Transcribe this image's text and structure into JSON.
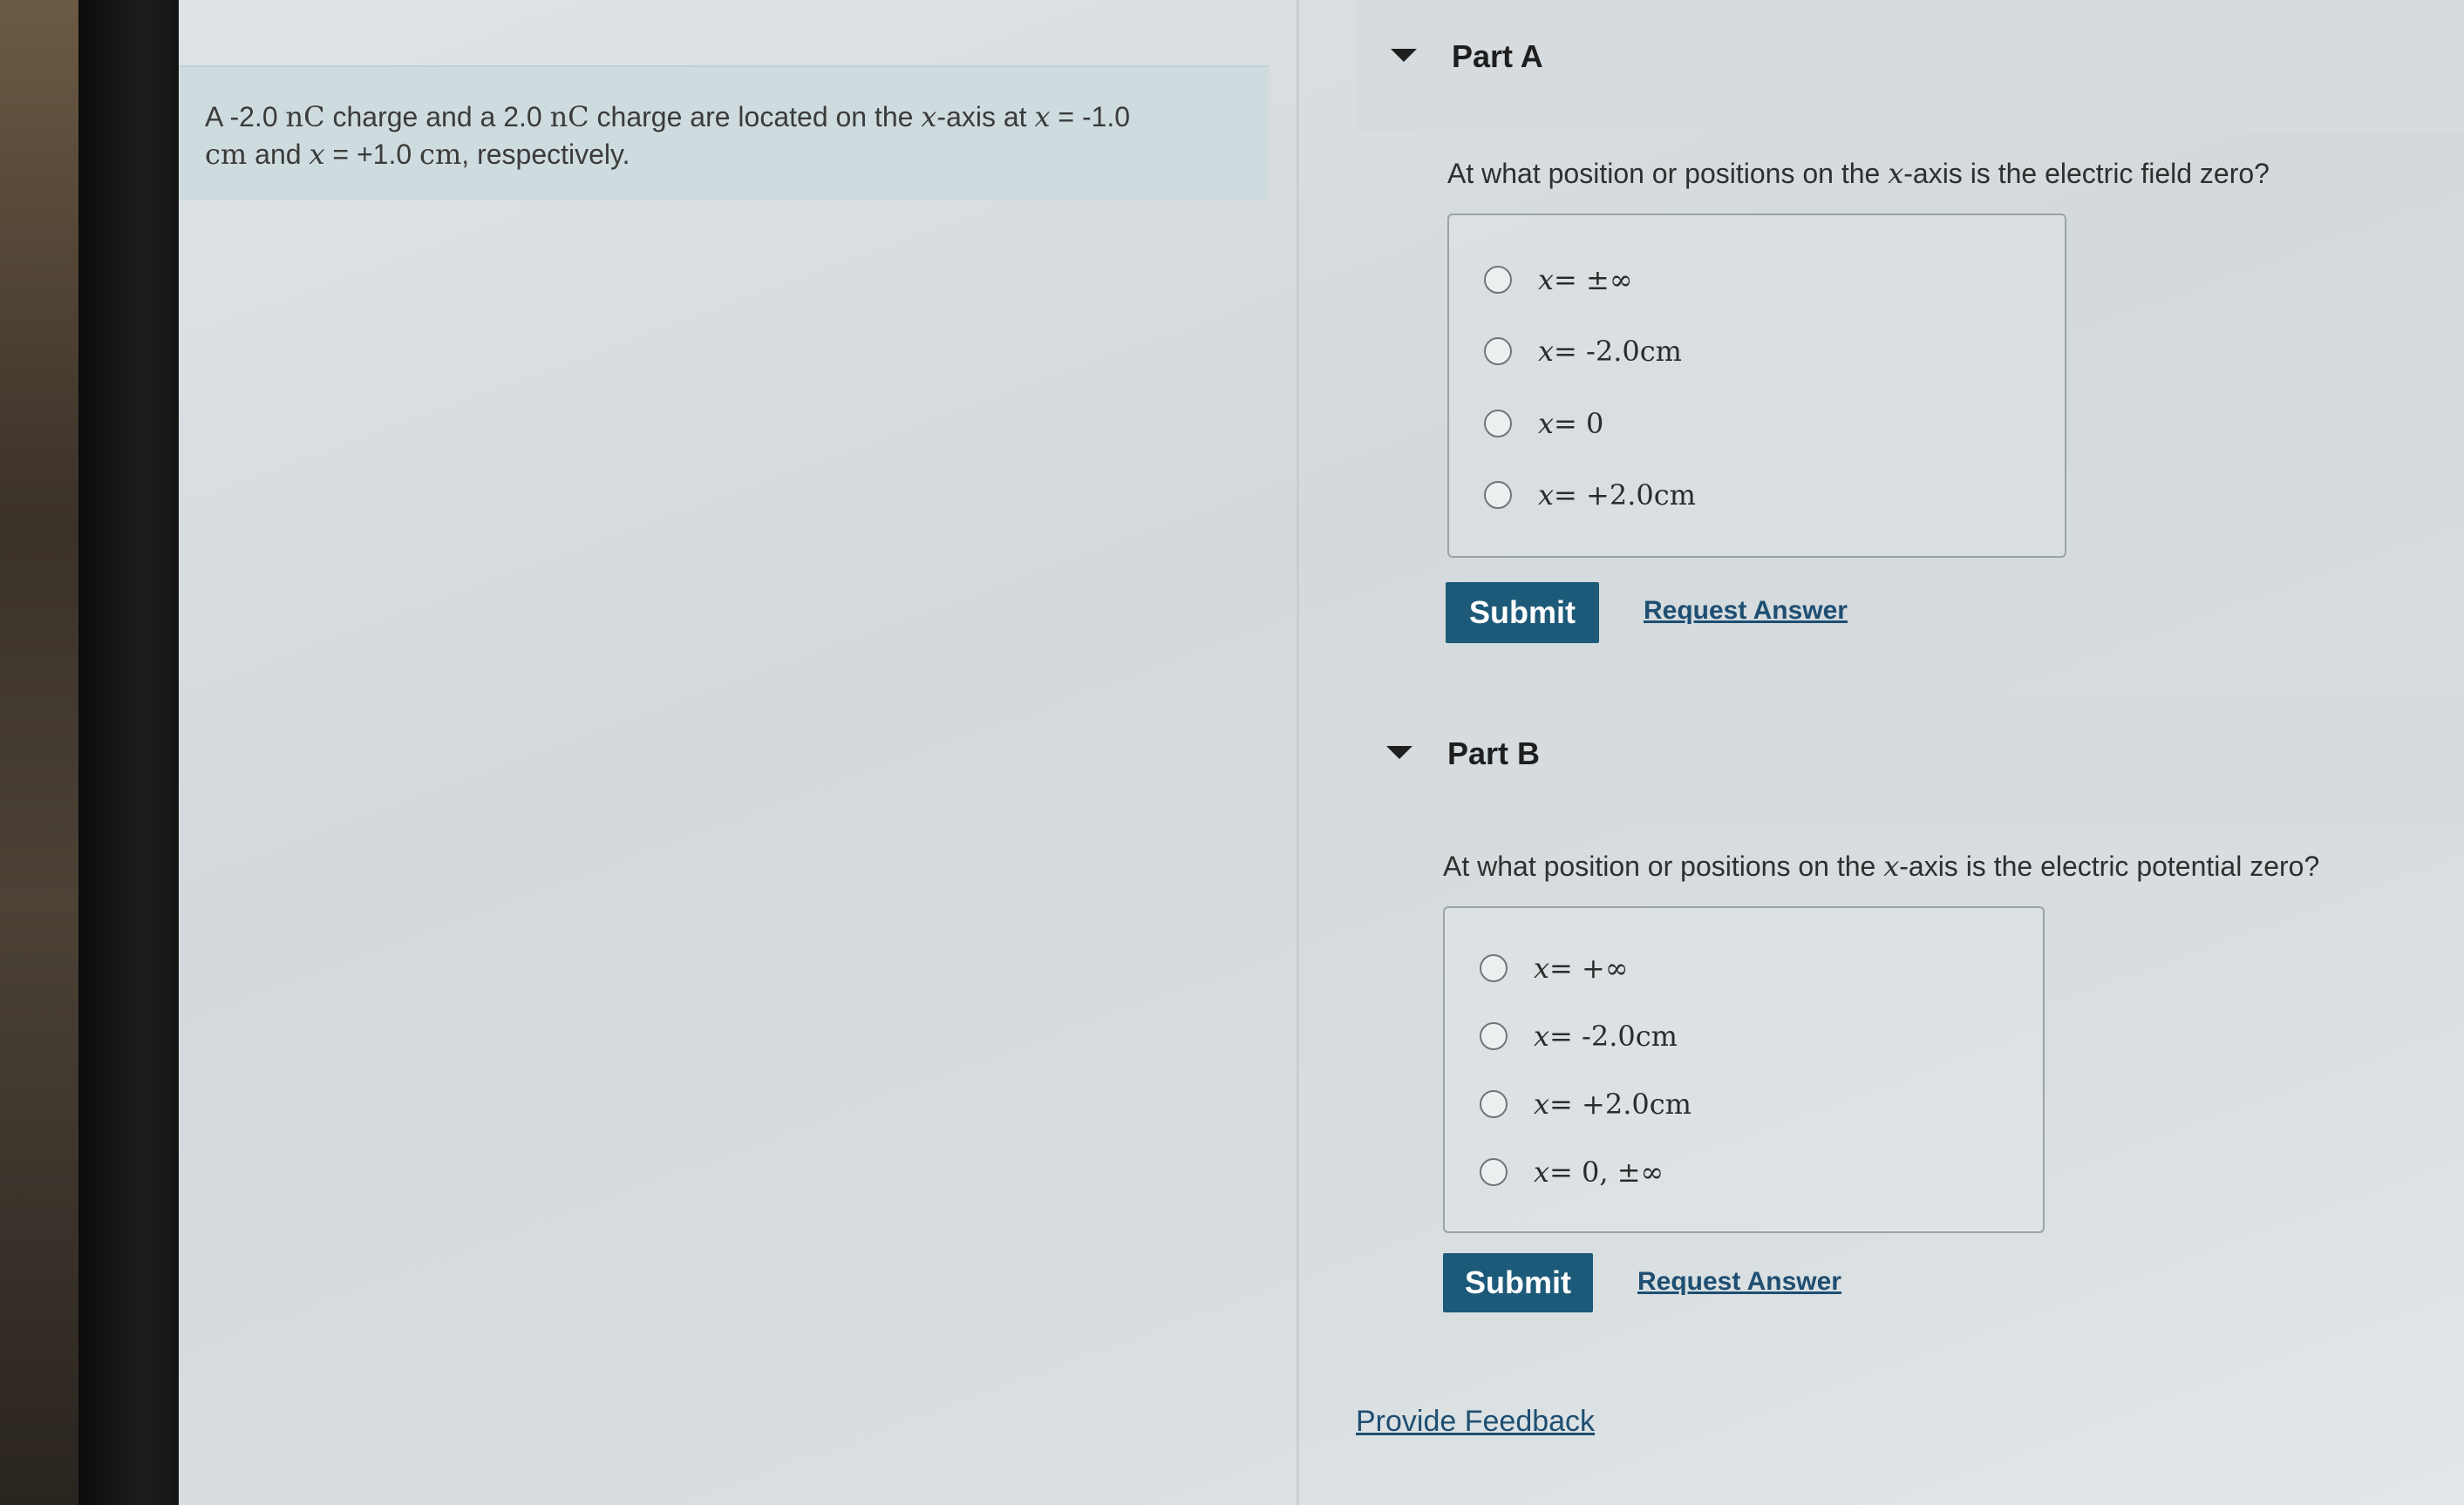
{
  "problem": {
    "seg1": "A -2.0 ",
    "unit1": "nC",
    "seg2": " charge and a 2.0 ",
    "unit2": "nC",
    "seg3": " charge are located on the ",
    "var1": "x",
    "seg4": "-axis at ",
    "var2": "x",
    "seg5": " = -1.0",
    "unit3": "cm",
    "seg6": " and ",
    "var3": "x",
    "seg7": " = +1.0 ",
    "unit4": "cm",
    "seg8": ", respectively."
  },
  "part_a": {
    "title": "Part A",
    "question_pre": "At what position or positions on the ",
    "question_var": "x",
    "question_post": "-axis is the electric field zero?",
    "choices": [
      {
        "var": "x",
        "value": " = ±∞",
        "unit": ""
      },
      {
        "var": "x",
        "value": " = -2.0 ",
        "unit": "cm"
      },
      {
        "var": "x",
        "value": " = 0",
        "unit": ""
      },
      {
        "var": "x",
        "value": " = +2.0 ",
        "unit": "cm"
      }
    ],
    "submit_label": "Submit",
    "request_label": "Request Answer"
  },
  "part_b": {
    "title": "Part B",
    "question_pre": "At what position or positions on the ",
    "question_var": "x",
    "question_post": "-axis is the electric potential zero?",
    "choices": [
      {
        "var": "x",
        "value": " = +∞",
        "unit": ""
      },
      {
        "var": "x",
        "value": " = -2.0 ",
        "unit": "cm"
      },
      {
        "var": "x",
        "value": " = +2.0 ",
        "unit": "cm"
      },
      {
        "var": "x",
        "value": " = 0, ±∞",
        "unit": ""
      }
    ],
    "submit_label": "Submit",
    "request_label": "Request Answer"
  },
  "feedback_label": "Provide Feedback",
  "colors": {
    "submit_bg": "#1d5a79",
    "link": "#1e4e72",
    "problem_bg": "#cfdcdf"
  },
  "icons": {
    "part_toggle": "caret-down-icon",
    "choice": "radio-button-icon"
  }
}
